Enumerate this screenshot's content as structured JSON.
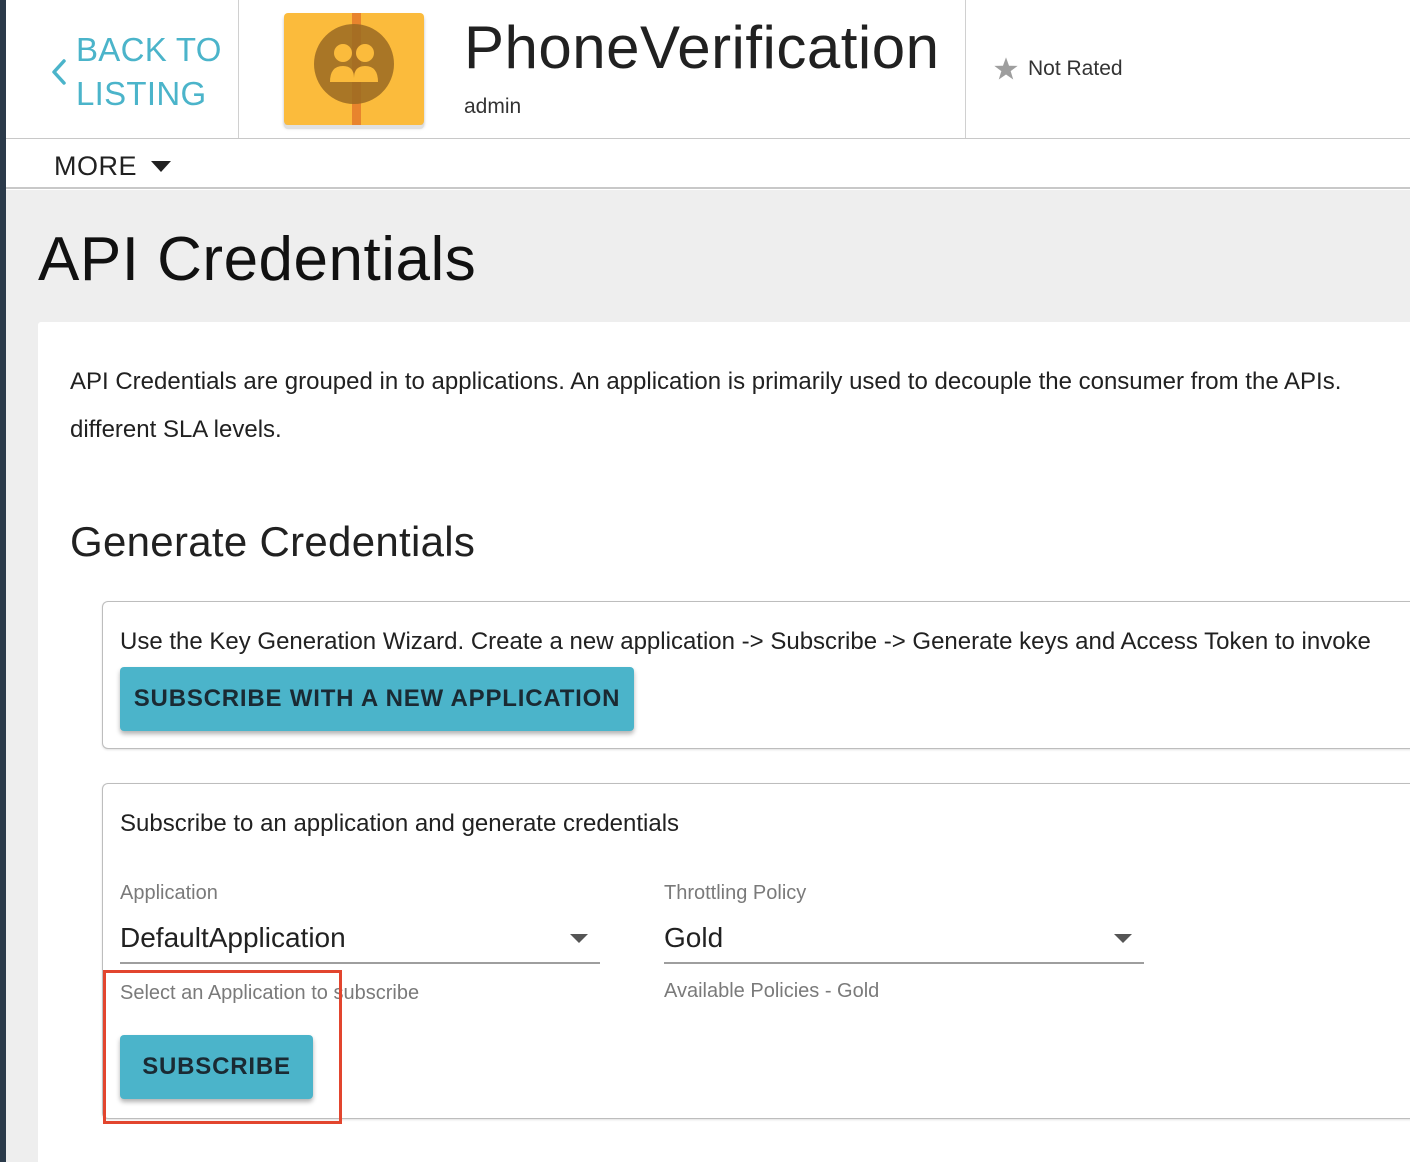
{
  "header": {
    "back_link_label": "BACK TO\nLISTING",
    "api_name": "PhoneVerification",
    "api_owner": "admin",
    "rating_label": "Not Rated"
  },
  "more_menu": {
    "label": "MORE"
  },
  "page": {
    "title": "API Credentials",
    "description_line1": "API Credentials are grouped in to applications. An application is primarily used to decouple the consumer from the APIs.",
    "description_line2": "different SLA levels.",
    "generate_title": "Generate Credentials"
  },
  "wizard_card": {
    "text": "Use the Key Generation Wizard. Create a new application -> Subscribe -> Generate keys and Access Token to invoke",
    "button_label": "SUBSCRIBE WITH A NEW APPLICATION"
  },
  "subscribe_card": {
    "text": "Subscribe to an application and generate credentials",
    "application_label": "Application",
    "application_value": "DefaultApplication",
    "application_helper": "Select an Application to subscribe",
    "policy_label": "Throttling Policy",
    "policy_value": "Gold",
    "policy_helper": "Available Policies - Gold",
    "button_label": "SUBSCRIBE"
  },
  "colors": {
    "accent": "#4bb4ca",
    "logo_bg": "#fbbb3c",
    "logo_stripe": "#e8842d",
    "highlight": "#e2452e",
    "page_bg": "#eeeeee"
  },
  "icons": {
    "back": "chevron-left-icon",
    "rating": "star-icon",
    "more": "caret-down-icon",
    "logo": "users-circle-icon"
  }
}
